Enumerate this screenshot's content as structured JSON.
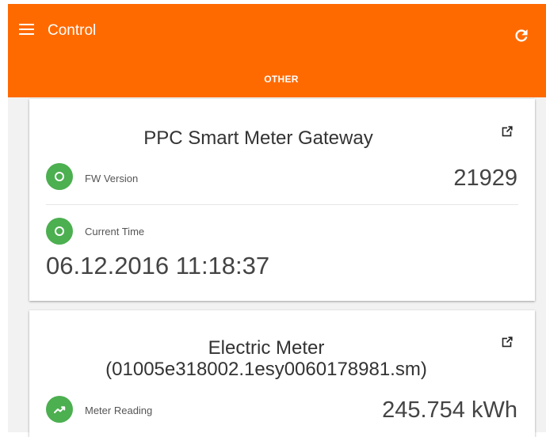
{
  "appbar": {
    "title": "Control",
    "menu_icon": "menu-icon",
    "refresh_icon": "refresh-icon",
    "color": "#ff6a00",
    "tabs": [
      {
        "label": "OTHER",
        "selected": true
      }
    ]
  },
  "cards": [
    {
      "title": "PPC Smart Meter Gateway",
      "link_icon": "open-external-icon",
      "rows": [
        {
          "label": "FW Version",
          "value": "21929",
          "icon": "circle-status-icon",
          "icon_color": "#4caf50"
        },
        {
          "label": "Current Time",
          "value": "06.12.2016 11:18:37",
          "icon": "circle-status-icon",
          "icon_color": "#4caf50"
        }
      ]
    },
    {
      "title_line1": "Electric Meter",
      "title_line2": "(01005e318002.1esy0060178981.sm)",
      "link_icon": "open-external-icon",
      "rows": [
        {
          "label": "Meter Reading",
          "value": "245.754 kWh",
          "icon": "trending-up-icon",
          "icon_color": "#4caf50"
        }
      ]
    }
  ]
}
